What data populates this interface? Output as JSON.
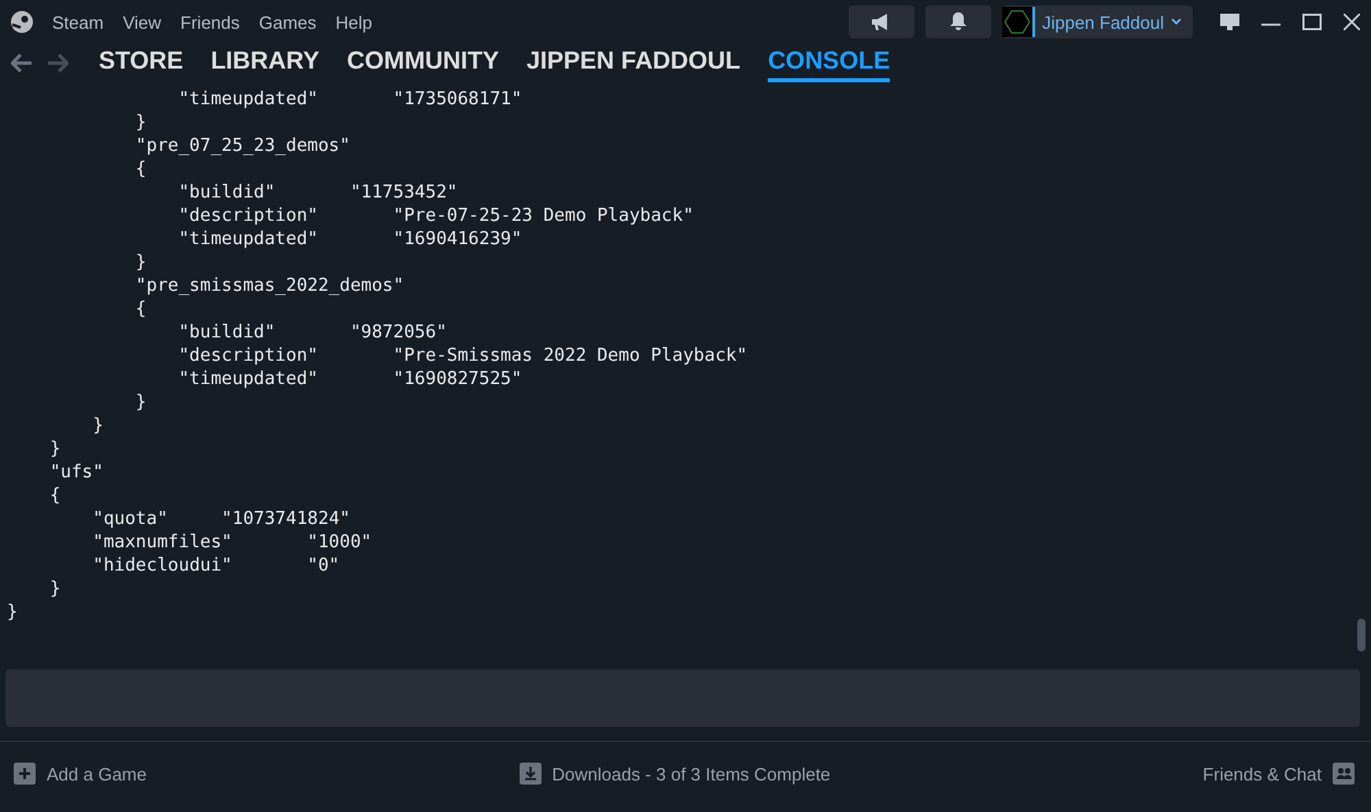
{
  "menu": [
    "Steam",
    "View",
    "Friends",
    "Games",
    "Help"
  ],
  "account": {
    "name": "Jippen Faddoul"
  },
  "nav": [
    {
      "label": "STORE",
      "selected": false
    },
    {
      "label": "LIBRARY",
      "selected": false
    },
    {
      "label": "COMMUNITY",
      "selected": false
    },
    {
      "label": "JIPPEN FADDOUL",
      "selected": false
    },
    {
      "label": "CONSOLE",
      "selected": true
    }
  ],
  "console_lines": [
    "\t\t\t\t\"timeupdated\"\t\t\"1735068171\"",
    "\t\t\t}",
    "\t\t\t\"pre_07_25_23_demos\"",
    "\t\t\t{",
    "\t\t\t\t\"buildid\"\t\t\"11753452\"",
    "\t\t\t\t\"description\"\t\t\"Pre-07-25-23 Demo Playback\"",
    "\t\t\t\t\"timeupdated\"\t\t\"1690416239\"",
    "\t\t\t}",
    "\t\t\t\"pre_smissmas_2022_demos\"",
    "\t\t\t{",
    "\t\t\t\t\"buildid\"\t\t\"9872056\"",
    "\t\t\t\t\"description\"\t\t\"Pre-Smissmas 2022 Demo Playback\"",
    "\t\t\t\t\"timeupdated\"\t\t\"1690827525\"",
    "\t\t\t}",
    "\t\t}",
    "\t}",
    "\t\"ufs\"",
    "\t{",
    "\t\t\"quota\"\t\t\"1073741824\"",
    "\t\t\"maxnumfiles\"\t\t\"1000\"",
    "\t\t\"hidecloudui\"\t\t\"0\"",
    "\t}",
    "}"
  ],
  "footer": {
    "add_game": "Add a Game",
    "downloads": "Downloads - 3 of 3 Items Complete",
    "friends": "Friends & Chat"
  }
}
